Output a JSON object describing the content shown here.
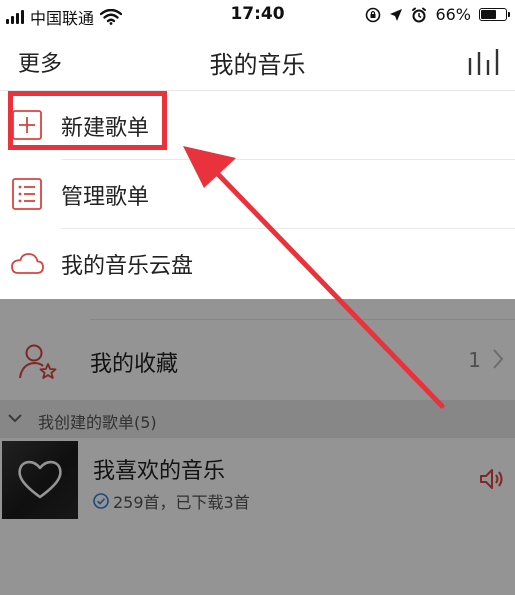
{
  "status_bar": {
    "carrier": "中国联通",
    "time": "17:40",
    "battery_percent": "66%",
    "battery_level": 0.66
  },
  "nav": {
    "left_label": "更多",
    "title": "我的音乐",
    "right_icon": "equalizer-icon"
  },
  "menu": {
    "items": [
      {
        "label": "新建歌单",
        "icon": "plus-square-icon"
      },
      {
        "label": "管理歌单",
        "icon": "list-icon"
      },
      {
        "label": "我的音乐云盘",
        "icon": "cloud-icon"
      }
    ]
  },
  "content": {
    "collect_label": "我的收藏",
    "collect_count": "1",
    "section_title": "我创建的歌单(5)",
    "playlist": {
      "name": "我喜欢的音乐",
      "meta": "259首，已下载3首"
    }
  },
  "colors": {
    "accent": "#e8323c",
    "icon_red": "#d9443f"
  }
}
